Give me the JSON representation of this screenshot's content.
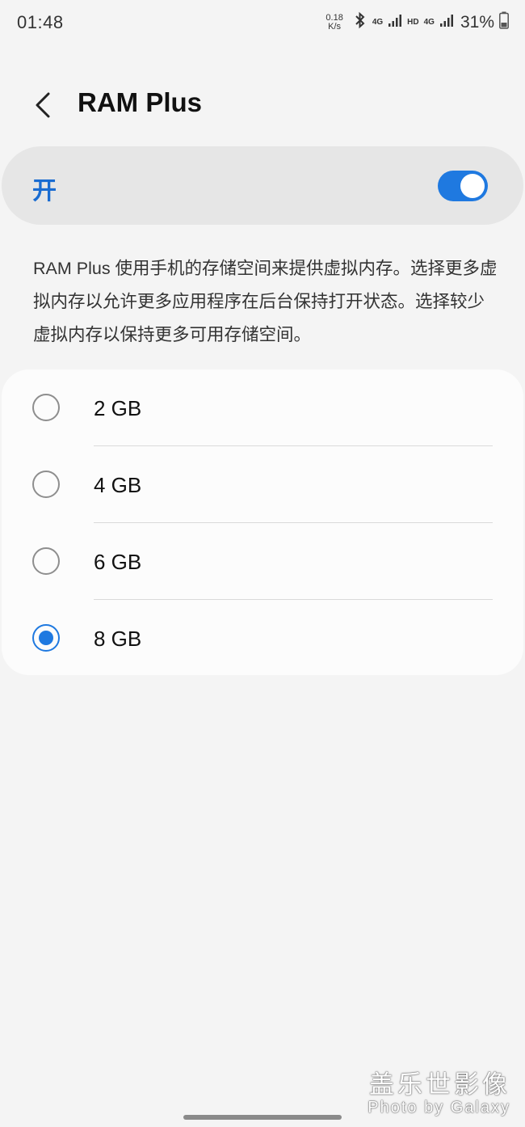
{
  "status_bar": {
    "time": "01:48",
    "net_speed_value": "0.18",
    "net_speed_unit": "K/s",
    "network_1": "4G",
    "hd": "HD",
    "network_2": "4G",
    "battery": "31%"
  },
  "header": {
    "back_icon": "chevron-left-icon",
    "title": "RAM Plus"
  },
  "master_switch": {
    "label": "开",
    "on": true,
    "accent": "#1f79e0"
  },
  "description": "RAM Plus 使用手机的存储空间来提供虚拟内存。选择更多虚拟内存以允许更多应用程序在后台保持打开状态。选择较少虚拟内存以保持更多可用存储空间。",
  "options": [
    {
      "label": "2 GB",
      "selected": false
    },
    {
      "label": "4 GB",
      "selected": false
    },
    {
      "label": "6 GB",
      "selected": false
    },
    {
      "label": "8 GB",
      "selected": true
    }
  ],
  "watermark": {
    "title": "盖乐世影像",
    "subtitle": "Photo by Galaxy"
  }
}
